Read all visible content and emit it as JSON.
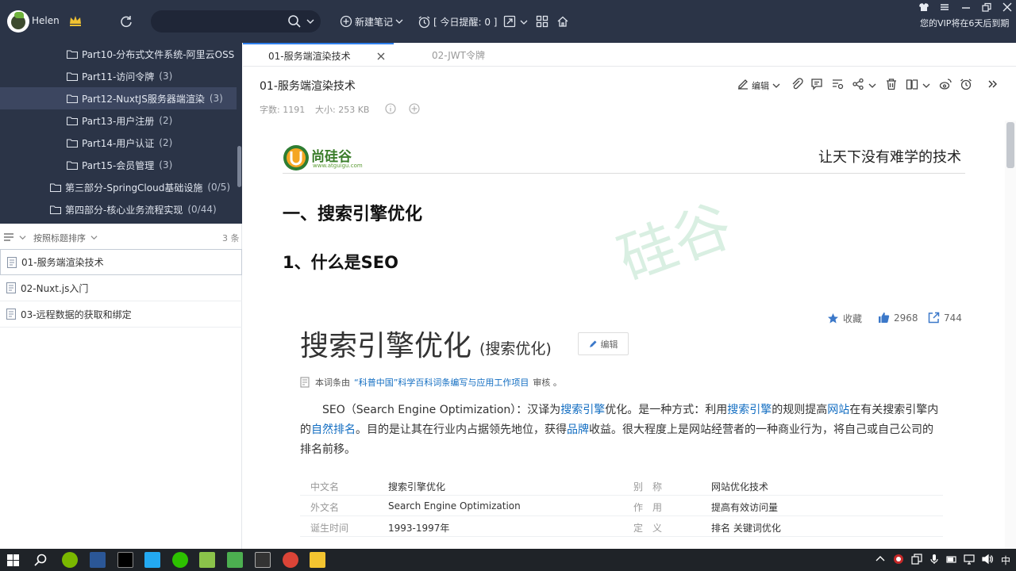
{
  "user": {
    "name": "Helen"
  },
  "search": {
    "placeholder": ""
  },
  "toolbar": {
    "new_note": "新建笔记",
    "reminder": "[ 今日提醒: 0 ]"
  },
  "vip_notice": "您的VIP将在6天后到期",
  "notebook_tree": [
    {
      "label": "Part10-分布式文件系统-阿里云OSS",
      "count": ""
    },
    {
      "label": "Part11-访问令牌",
      "count": "(3)"
    },
    {
      "label": "Part12-NuxtJS服务器端渲染",
      "count": "(3)",
      "selected": true
    },
    {
      "label": "Part13-用户注册",
      "count": "(2)"
    },
    {
      "label": "Part14-用户认证",
      "count": "(2)"
    },
    {
      "label": "Part15-会员管理",
      "count": "(3)"
    },
    {
      "label": "第三部分-SpringCloud基础设施",
      "count": "(0/5)"
    },
    {
      "label": "第四部分-核心业务流程实现",
      "count": "(0/44)"
    }
  ],
  "sort": {
    "label": "按照标题排序",
    "count": "3 条"
  },
  "notes": [
    {
      "title": "01-服务端渲染技术",
      "active": true
    },
    {
      "title": "02-Nuxt.js入门"
    },
    {
      "title": "03-远程数据的获取和绑定"
    }
  ],
  "tabs": [
    {
      "label": "01-服务端渲染技术",
      "active": true
    },
    {
      "label": "02-JWT令牌"
    }
  ],
  "note": {
    "title": "01-服务端渲染技术",
    "word_count": "字数: 1191",
    "size": "大小: 253 KB",
    "edit_label": "编辑"
  },
  "doc": {
    "logo_text": "尚硅谷",
    "logo_url": "www.atguigu.com",
    "slogan": "让天下没有难学的技术",
    "watermark": "硅谷",
    "h1": "一、搜索引擎优化",
    "h2": "1、什么是SEO"
  },
  "baike": {
    "favorite": "收藏",
    "likes": "2968",
    "shares": "744",
    "title": "搜索引擎优化",
    "subtitle": "(搜索优化)",
    "edit": "编辑",
    "source_prefix": "本词条由",
    "source_link": "“科普中国”科学百科词条编写与应用工作项目",
    "source_suffix": "审核 。",
    "para_1": "SEO（Search Engine Optimization）：汉译为",
    "link_1": "搜索引擎",
    "para_2": "优化。是一种方式：利用",
    "link_2": "搜索引擎",
    "para_3": "的规则提高",
    "link_3": "网站",
    "para_4": "在有关搜索引擎内的",
    "link_4": "自然排名",
    "para_5": "。目的是让其在行业内占据领先地位，获得",
    "link_5": "品牌",
    "para_6": "收益。很大程度上是网站经营者的一种商业行为，将自己或自己公司的排名前移。",
    "table": [
      {
        "k1": "中文名",
        "v1": "搜索引擎优化",
        "k2": "别　称",
        "v2": "网站优化技术"
      },
      {
        "k1": "外文名",
        "v1": "Search Engine Optimization",
        "k2": "作　用",
        "v2": "提高有效访问量"
      },
      {
        "k1": "诞生时间",
        "v1": "1993-1997年",
        "k2": "定　义",
        "v2": "排名 关键词优化"
      }
    ]
  },
  "taskbar": {
    "ime": "中"
  },
  "colors": {
    "topbar": "#2b3447",
    "accent": "#2f80ed",
    "link": "#136ec2"
  }
}
